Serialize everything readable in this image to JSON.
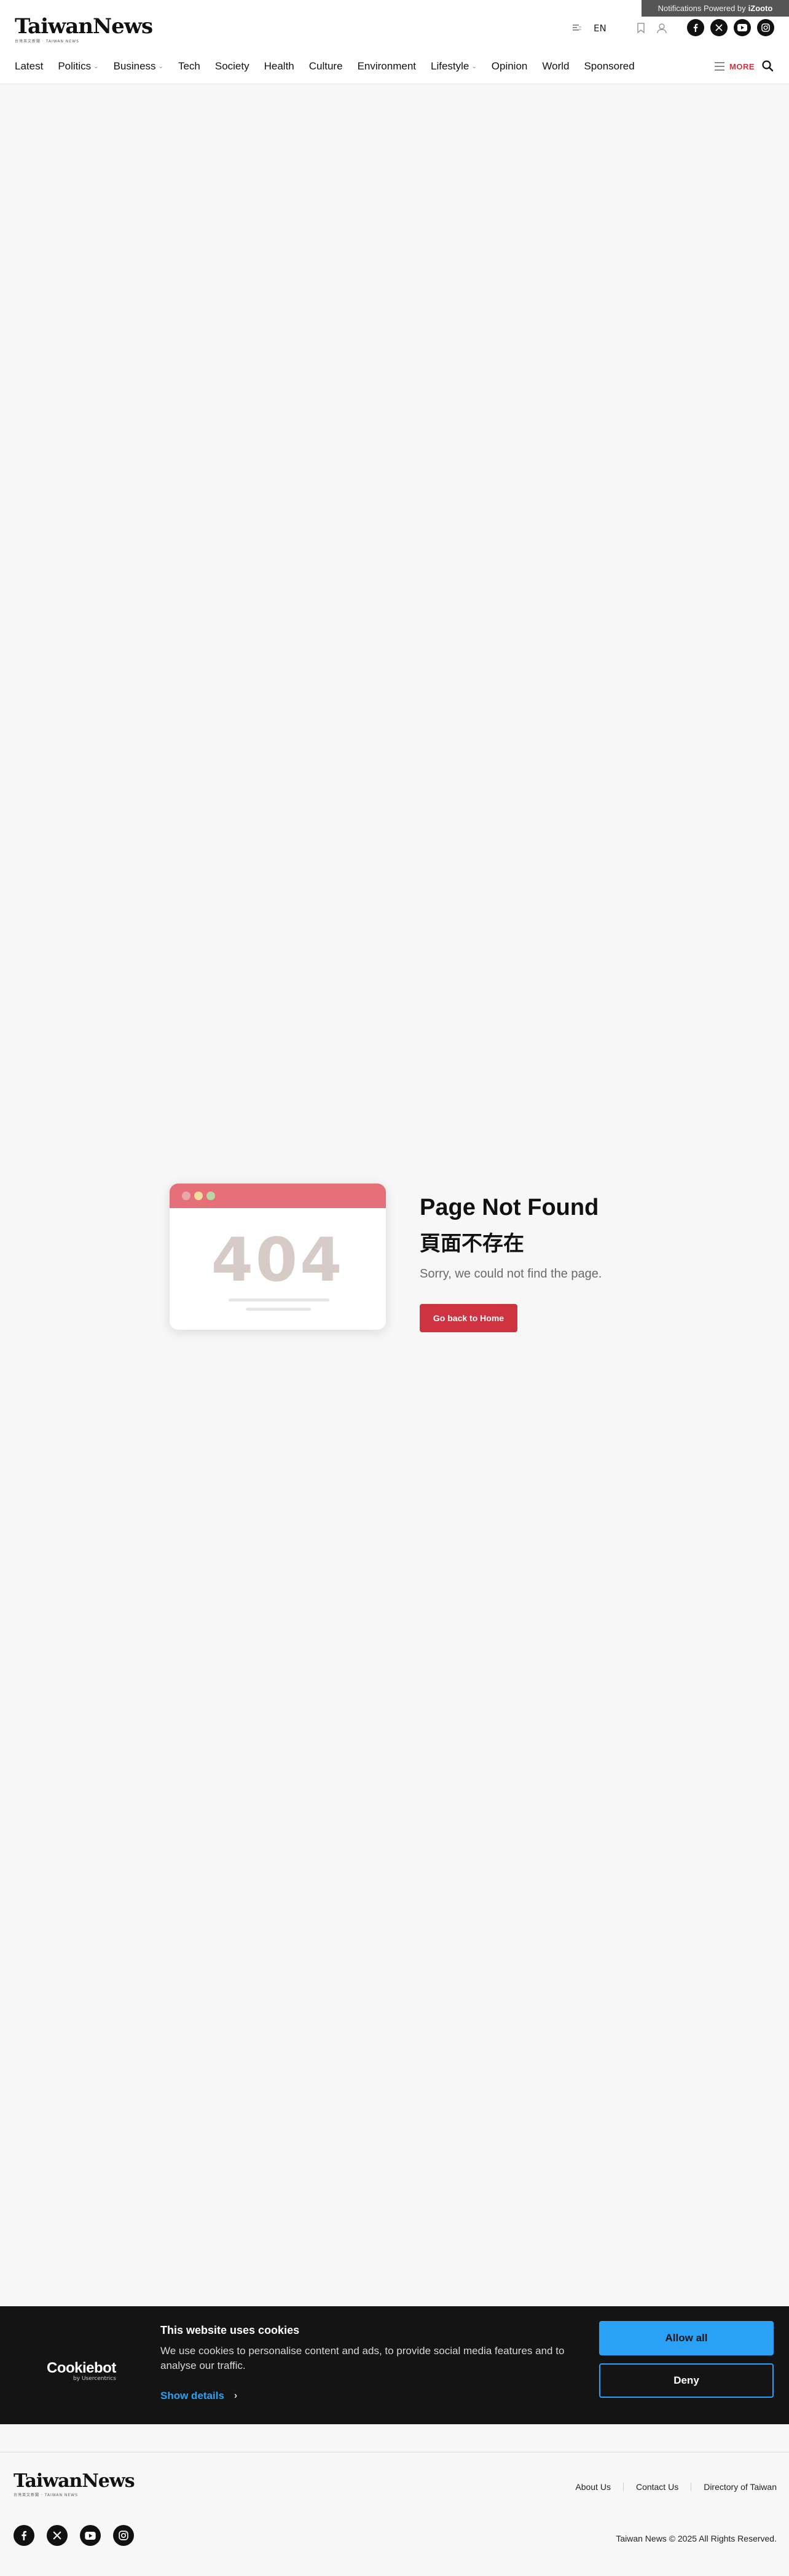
{
  "notification": {
    "prefix": "Notifications Powered by",
    "brand": "iZooto"
  },
  "header": {
    "logo_text": "TaiwanNews",
    "logo_sub": "台灣英文新聞 · TAIWAN NEWS",
    "language": "EN",
    "nav": [
      {
        "label": "Latest",
        "dropdown": false
      },
      {
        "label": "Politics",
        "dropdown": true
      },
      {
        "label": "Business",
        "dropdown": true
      },
      {
        "label": "Tech",
        "dropdown": false
      },
      {
        "label": "Society",
        "dropdown": false
      },
      {
        "label": "Health",
        "dropdown": false
      },
      {
        "label": "Culture",
        "dropdown": false
      },
      {
        "label": "Environment",
        "dropdown": false
      },
      {
        "label": "Lifestyle",
        "dropdown": true
      },
      {
        "label": "Opinion",
        "dropdown": false
      },
      {
        "label": "World",
        "dropdown": false
      },
      {
        "label": "Sponsored",
        "dropdown": false
      }
    ],
    "more_label": "MORE",
    "social": [
      "facebook-icon",
      "x-icon",
      "youtube-icon",
      "instagram-icon"
    ]
  },
  "error": {
    "code": "404",
    "title": "Page Not Found",
    "title_zh": "頁面不存在",
    "message": "Sorry, we could not find the page.",
    "button": "Go back to Home",
    "dot_colors": [
      "#e8a8a8",
      "#f4dc9c",
      "#b9d6a4"
    ]
  },
  "cookie": {
    "brand": "Cookiebot",
    "brand_sub": "by Usercentrics",
    "title": "This website uses cookies",
    "text": "We use cookies to personalise content and ads, to provide social media features and to analyse our traffic.",
    "details": "Show details",
    "allow": "Allow all",
    "deny": "Deny"
  },
  "footer": {
    "logo_text": "TaiwanNews",
    "logo_sub": "台灣英文新聞 · TAIWAN NEWS",
    "links": [
      "About Us",
      "Contact Us",
      "Directory of Taiwan"
    ],
    "copyright": "Taiwan News © 2025 All Rights Reserved."
  },
  "colors": {
    "accent": "#cf3340",
    "cookie_blue": "#2aa1f5",
    "card_bar": "#e67079"
  }
}
